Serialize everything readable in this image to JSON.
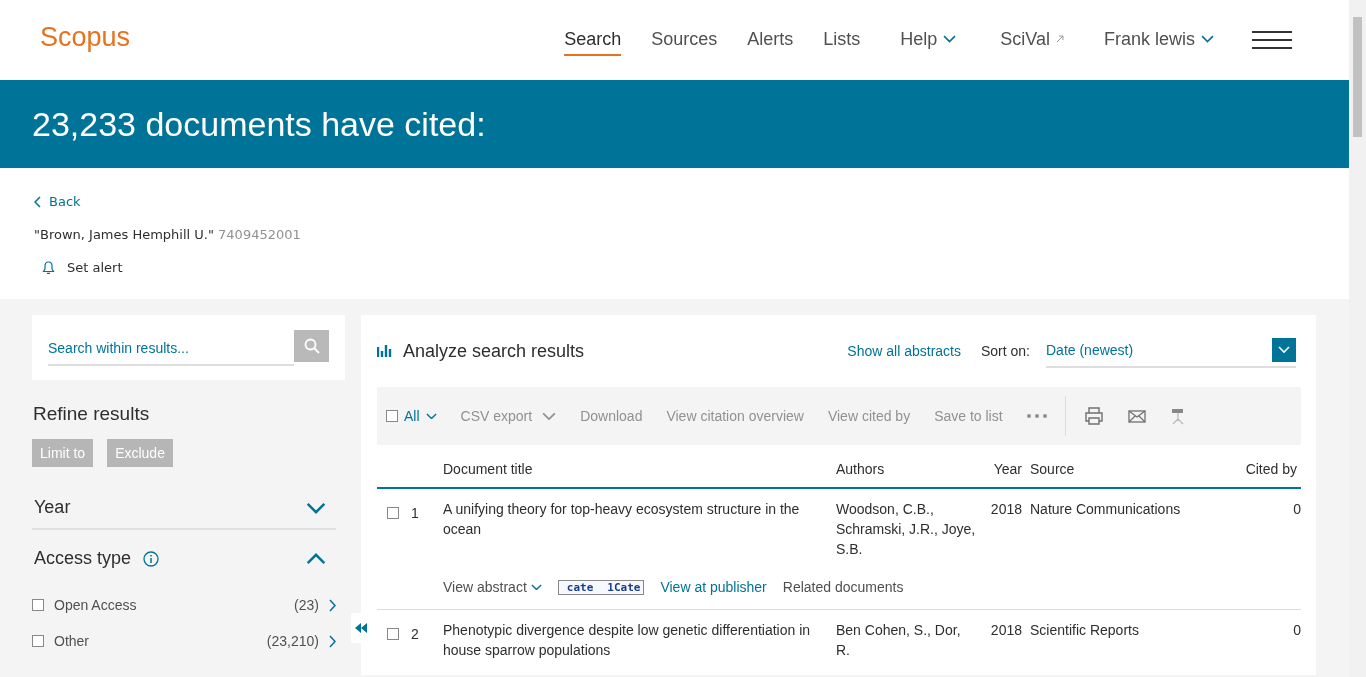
{
  "header": {
    "logo": "Scopus",
    "nav": [
      {
        "label": "Search",
        "selected": true,
        "kind": "plain"
      },
      {
        "label": "Sources",
        "selected": false,
        "kind": "plain"
      },
      {
        "label": "Alerts",
        "selected": false,
        "kind": "plain"
      },
      {
        "label": "Lists",
        "selected": false,
        "kind": "plain"
      },
      {
        "label": "Help",
        "selected": false,
        "kind": "dropdown"
      },
      {
        "label": "SciVal",
        "selected": false,
        "kind": "external"
      },
      {
        "label": "Frank lewis",
        "selected": false,
        "kind": "dropdown"
      }
    ]
  },
  "banner": {
    "title": "23,233 documents have cited:"
  },
  "context": {
    "back": "Back",
    "author": "\"Brown, James Hemphill U.\"",
    "author_id": "7409452001",
    "alert": "Set alert"
  },
  "filters": {
    "search": {
      "placeholder": "Search within results..."
    },
    "title": "Refine results",
    "buttons": [
      "Limit to",
      "Exclude"
    ],
    "facets": [
      {
        "label": "Year",
        "expanded": false,
        "info": false
      },
      {
        "label": "Access type",
        "expanded": true,
        "info": true,
        "options": [
          {
            "label": "Open Access",
            "count": "(23)",
            "checked": false
          },
          {
            "label": "Other",
            "count": "(23,210)",
            "checked": false
          }
        ]
      }
    ]
  },
  "results": {
    "analyze": "Analyze search results",
    "show_abstracts": "Show all abstracts",
    "sort_label": "Sort on:",
    "sort_value": "Date (newest)",
    "toolbar": {
      "all": "All",
      "all_checked": false,
      "actions": [
        {
          "label": "CSV export",
          "kind": "dropdown"
        },
        {
          "label": "Download",
          "kind": "plain"
        },
        {
          "label": "View citation overview",
          "kind": "plain"
        },
        {
          "label": "View cited by",
          "kind": "plain"
        },
        {
          "label": "Save to list",
          "kind": "plain"
        }
      ]
    },
    "columns": [
      "Document title",
      "Authors",
      "Year",
      "Source",
      "Cited by"
    ],
    "rows": [
      {
        "number": "1",
        "checked": false,
        "title": "A unifying theory for top-heavy ecosystem structure in the ocean",
        "authors": "Woodson, C.B., Schramski, J.R., Joye, S.B.",
        "year": "2018",
        "source": "Nature Communications",
        "cited_by": "0",
        "links": {
          "abstract": "View abstract",
          "badge": [
            "cate",
            "1Cate"
          ],
          "publisher": "View at publisher",
          "related": "Related documents"
        }
      },
      {
        "number": "2",
        "checked": false,
        "title": "Phenotypic divergence despite low genetic differentiation in house sparrow populations",
        "authors": "Ben Cohen, S., Dor, R.",
        "year": "2018",
        "source": "Scientific Reports",
        "cited_by": "0"
      }
    ]
  }
}
